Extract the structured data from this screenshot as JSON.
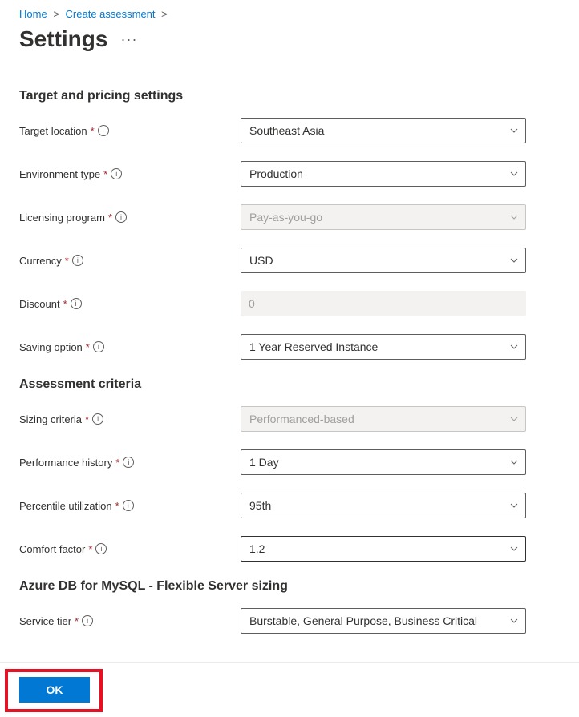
{
  "breadcrumb": {
    "home": "Home",
    "create": "Create assessment"
  },
  "header": {
    "title": "Settings"
  },
  "sections": {
    "target_pricing": "Target and pricing settings",
    "assessment_criteria": "Assessment criteria",
    "azure_db": "Azure DB for MySQL - Flexible Server sizing"
  },
  "fields": {
    "target_location": {
      "label": "Target location",
      "value": "Southeast Asia"
    },
    "environment_type": {
      "label": "Environment type",
      "value": "Production"
    },
    "licensing_program": {
      "label": "Licensing program",
      "value": "Pay-as-you-go"
    },
    "currency": {
      "label": "Currency",
      "value": "USD"
    },
    "discount": {
      "label": "Discount",
      "value": "0"
    },
    "saving_option": {
      "label": "Saving option",
      "value": "1 Year Reserved Instance"
    },
    "sizing_criteria": {
      "label": "Sizing criteria",
      "value": "Performanced-based"
    },
    "performance_history": {
      "label": "Performance history",
      "value": "1 Day"
    },
    "percentile_utilization": {
      "label": "Percentile utilization",
      "value": "95th"
    },
    "comfort_factor": {
      "label": "Comfort factor",
      "value": "1.2"
    },
    "service_tier": {
      "label": "Service tier",
      "value": "Burstable, General Purpose, Business Critical"
    }
  },
  "footer": {
    "ok_label": "OK"
  }
}
